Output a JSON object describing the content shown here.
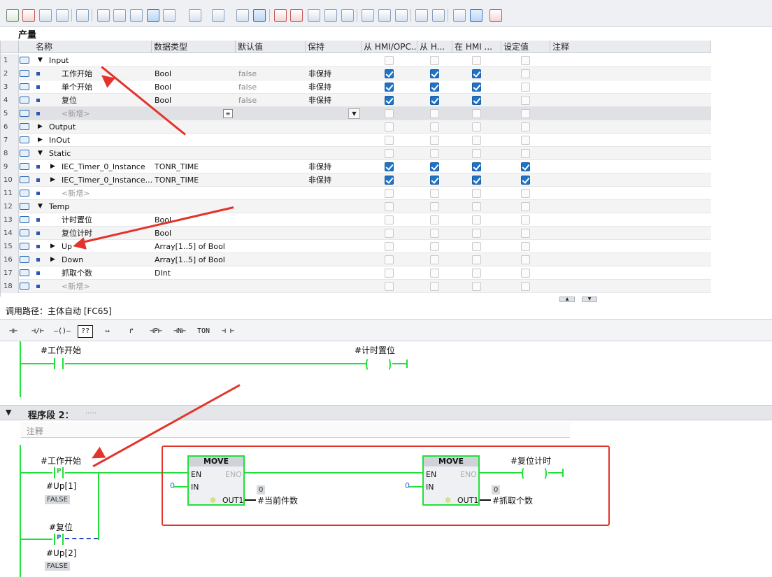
{
  "interface": {
    "title": "产量",
    "columns": [
      "名称",
      "数据类型",
      "默认值",
      "保持",
      "从 HMI/OPC...",
      "从 H...",
      "在 HMI ...",
      "设定值",
      "注释"
    ],
    "rows": [
      {
        "num": "1",
        "name": "Input",
        "expand": "▼",
        "indent": 0,
        "type": "",
        "default": "",
        "retain": "",
        "cb": [
          false,
          false,
          false,
          false
        ]
      },
      {
        "num": "2",
        "name": "工作开始",
        "expand": "",
        "indent": 1,
        "type": "Bool",
        "default": "false",
        "retain": "非保持",
        "cb": [
          true,
          true,
          true,
          false
        ]
      },
      {
        "num": "3",
        "name": "单个开始",
        "expand": "",
        "indent": 1,
        "type": "Bool",
        "default": "false",
        "retain": "非保持",
        "cb": [
          true,
          true,
          true,
          false
        ]
      },
      {
        "num": "4",
        "name": "复位",
        "expand": "",
        "indent": 1,
        "type": "Bool",
        "default": "false",
        "retain": "非保持",
        "cb": [
          true,
          true,
          true,
          false
        ]
      },
      {
        "num": "5",
        "name": "<新增>",
        "expand": "",
        "indent": 1,
        "type": "",
        "default": "",
        "retain": "",
        "cb": [
          false,
          false,
          false,
          false
        ],
        "add": true
      },
      {
        "num": "6",
        "name": "Output",
        "expand": "▶",
        "indent": 0,
        "type": "",
        "default": "",
        "retain": "",
        "cb": [
          false,
          false,
          false,
          false
        ]
      },
      {
        "num": "7",
        "name": "InOut",
        "expand": "▶",
        "indent": 0,
        "type": "",
        "default": "",
        "retain": "",
        "cb": [
          false,
          false,
          false,
          false
        ]
      },
      {
        "num": "8",
        "name": "Static",
        "expand": "▼",
        "indent": 0,
        "type": "",
        "default": "",
        "retain": "",
        "cb": [
          false,
          false,
          false,
          false
        ]
      },
      {
        "num": "9",
        "name": "IEC_Timer_0_Instance",
        "expand": "▶",
        "indent": 1,
        "type": "TONR_TIME",
        "default": "",
        "retain": "非保持",
        "cb": [
          true,
          true,
          true,
          true
        ]
      },
      {
        "num": "10",
        "name": "IEC_Timer_0_Instance...",
        "expand": "▶",
        "indent": 1,
        "type": "TONR_TIME",
        "default": "",
        "retain": "非保持",
        "cb": [
          true,
          true,
          true,
          true
        ]
      },
      {
        "num": "11",
        "name": "<新增>",
        "expand": "",
        "indent": 1,
        "type": "",
        "default": "",
        "retain": "",
        "cb": [
          false,
          false,
          false,
          false
        ],
        "add": true
      },
      {
        "num": "12",
        "name": "Temp",
        "expand": "▼",
        "indent": 0,
        "type": "",
        "default": "",
        "retain": "",
        "cb": [
          false,
          false,
          false,
          false
        ]
      },
      {
        "num": "13",
        "name": "计时置位",
        "expand": "",
        "indent": 1,
        "type": "Bool",
        "default": "",
        "retain": "",
        "cb": [
          false,
          false,
          false,
          false
        ]
      },
      {
        "num": "14",
        "name": "复位计时",
        "expand": "",
        "indent": 1,
        "type": "Bool",
        "default": "",
        "retain": "",
        "cb": [
          false,
          false,
          false,
          false
        ]
      },
      {
        "num": "15",
        "name": "Up",
        "expand": "▶",
        "indent": 1,
        "type": "Array[1..5] of Bool",
        "default": "",
        "retain": "",
        "cb": [
          false,
          false,
          false,
          false
        ]
      },
      {
        "num": "16",
        "name": "Down",
        "expand": "▶",
        "indent": 1,
        "type": "Array[1..5] of Bool",
        "default": "",
        "retain": "",
        "cb": [
          false,
          false,
          false,
          false
        ]
      },
      {
        "num": "17",
        "name": "抓取个数",
        "expand": "",
        "indent": 1,
        "type": "DInt",
        "default": "",
        "retain": "",
        "cb": [
          false,
          false,
          false,
          false
        ]
      },
      {
        "num": "18",
        "name": "<新增>",
        "expand": "",
        "indent": 1,
        "type": "",
        "default": "",
        "retain": "",
        "cb": [
          false,
          false,
          false,
          false
        ],
        "add": true
      }
    ]
  },
  "editor": {
    "call_path": "调用路径：主体自动 [FC65]",
    "ladder_buttons": [
      "⊣⊢",
      "⊣/⊢",
      "–()–",
      "??",
      "↦",
      "↱",
      "⊣P⊢",
      "⊣N⊢",
      "TON",
      "⊣ ⊢"
    ],
    "network1": {
      "contact_label": "#工作开始",
      "coil_label": "#计时置位"
    },
    "network2": {
      "title": "程序段 2：",
      "title_dots": ".....",
      "comment_placeholder": "注释",
      "contact1_label": "#工作开始",
      "contact1_type": "P",
      "contact1_edge": "#Up[1]",
      "contact1_state": "FALSE",
      "contact2_label": "#复位",
      "contact2_type": "P",
      "contact2_edge": "#Up[2]",
      "contact2_state": "FALSE",
      "move1": {
        "title": "MOVE",
        "en": "EN",
        "eno": "ENO",
        "in": "IN",
        "out": "OUT1",
        "in_value": "0",
        "out_value": "0",
        "out_target": "#当前件数"
      },
      "move2": {
        "title": "MOVE",
        "en": "EN",
        "eno": "ENO",
        "in": "IN",
        "out": "OUT1",
        "in_value": "0",
        "out_value": "0",
        "out_target": "#抓取个数"
      },
      "coil_label": "#复位计时"
    }
  },
  "colors": {
    "wire": "#22e03a",
    "highlight": "#e3342b",
    "checkbox_on": "#1c74c9"
  }
}
